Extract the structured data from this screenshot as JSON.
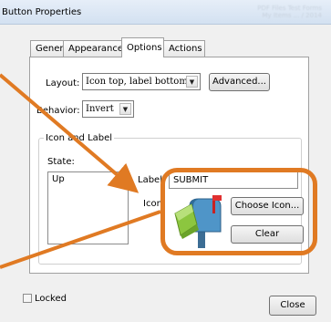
{
  "window": {
    "title": "Button Properties",
    "title_extra": [
      "PDF Files Test Forms",
      "My Items ... / 2014"
    ]
  },
  "tabs": [
    {
      "label": "General",
      "active": false
    },
    {
      "label": "Appearance",
      "active": false
    },
    {
      "label": "Options",
      "active": true
    },
    {
      "label": "Actions",
      "active": false
    }
  ],
  "options": {
    "layout_label": "Layout:",
    "layout_value": "Icon top, label bottom",
    "advanced_button": "Advanced...",
    "behavior_label": "Behavior:",
    "behavior_value": "Invert",
    "group_title": "Icon and Label",
    "state_label": "State:",
    "states": [
      "Up"
    ],
    "label_label": "Label:",
    "label_value": "SUBMIT",
    "icon_label": "Icon:",
    "icon_name": "mailbox-with-paper-icon",
    "choose_icon_button": "Choose Icon...",
    "clear_button": "Clear"
  },
  "footer": {
    "locked_label": "Locked",
    "locked_checked": false,
    "close_button": "Close"
  },
  "annotation": {
    "highlight_color": "#e07a23",
    "arrow_color": "#e07a23"
  }
}
